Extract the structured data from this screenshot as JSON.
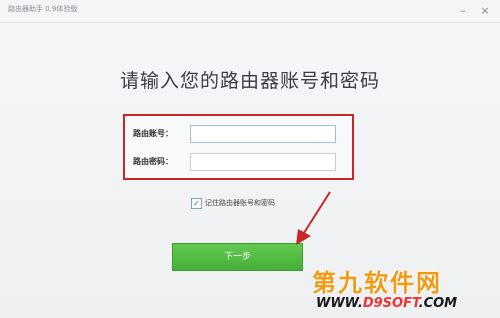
{
  "window": {
    "title": "路由器助手 0.9体验版",
    "minimize_icon": "minimize-icon",
    "close_icon": "close-icon",
    "minimize_glyph": "–",
    "close_glyph": "×"
  },
  "main": {
    "heading": "请输入您的路由器账号和密码",
    "account_label": "路由账号：",
    "account_value": "",
    "password_label": "路由密码：",
    "password_value": "",
    "remember_checked": true,
    "remember_label": "记住路由器账号和密码",
    "next_label": "下一步"
  },
  "colors": {
    "highlight_border": "#c62828",
    "next_button": "#52bb43",
    "watermark": "#f39a15",
    "arrow": "#c62828"
  },
  "watermark": {
    "title": "第九软件网",
    "url_prefix": "WWW.",
    "url_domain": "D9SOFT",
    "url_suffix": ".COM"
  }
}
